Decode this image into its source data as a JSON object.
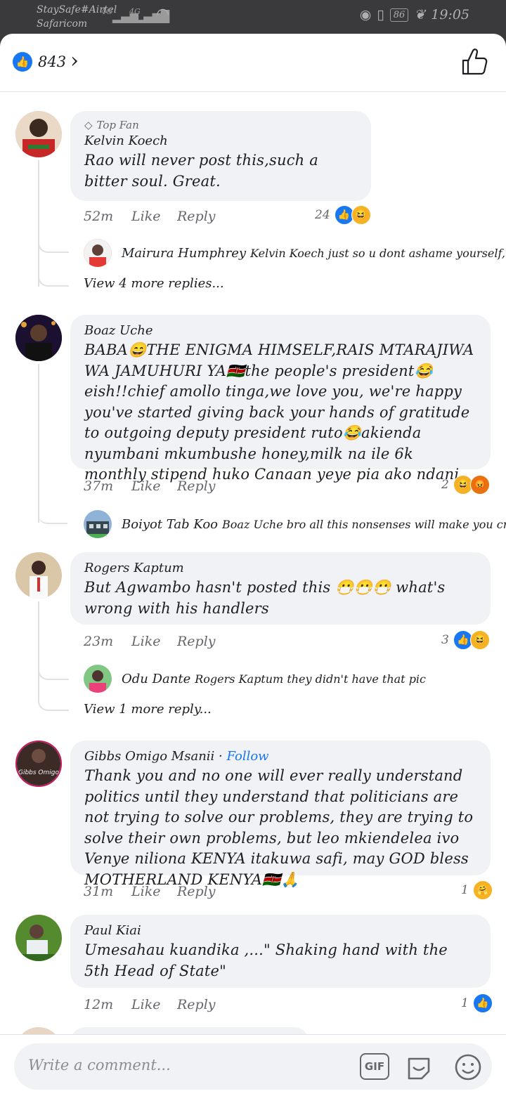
{
  "status": {
    "carrier1": "StaySafe#Airtel",
    "carrier2": "Safaricom",
    "net1": "4G",
    "net2": "4G",
    "battery": "86",
    "time": "19:05"
  },
  "header": {
    "like_count": "843"
  },
  "comments": [
    {
      "badge": "Top Fan",
      "author": "Kelvin Koech",
      "text": "Rao will never post this,such a bitter soul. Great.",
      "time": "52m",
      "like": "Like",
      "reply": "Reply",
      "reactions": "24",
      "reply_preview": {
        "name": "Mairura Humphrey",
        "text": "Kelvin Koech just so u dont ashame yourself, Ra..."
      },
      "more": "View 4 more replies..."
    },
    {
      "author": "Boaz Uche",
      "text": "BABA😄THE ENIGMA HIMSELF,RAIS MTARAJIWA WA JAMUHURI YA🇰🇪the people's president😂eish!!chief amollo tinga,we love you, we're happy you've started giving back your hands of gratitude to outgoing deputy president ruto😂akienda nyumbani mkumbushe honey,milk na ile 6k monthly stipend huko Canaan yeye pia ako ndani",
      "time": "37m",
      "like": "Like",
      "reply": "Reply",
      "reactions": "2",
      "reply_preview": {
        "name": "Boiyot Tab Koo",
        "text": "Boaz Uche bro all this nonsenses will make you cr..."
      }
    },
    {
      "author": "Rogers Kaptum",
      "text": "But Agwambo hasn't posted this 😷😷😷 what's wrong with his handlers",
      "time": "23m",
      "like": "Like",
      "reply": "Reply",
      "reactions": "3",
      "reply_preview": {
        "name": "Odu Dante",
        "text": "Rogers Kaptum they didn't have that pic"
      },
      "more": "View 1 more reply..."
    },
    {
      "author": "Gibbs Omigo  Msanii",
      "follow": "Follow",
      "text": "Thank you and no one will ever really understand politics until they understand that politicians are not trying to solve our problems, they are trying to solve their own problems, but leo mkiendelea ivo Venye niliona KENYA itakuwa safi, may GOD bless MOTHERLAND KENYA🇰🇪🙏",
      "time": "31m",
      "like": "Like",
      "reply": "Reply",
      "reactions": "1",
      "avatar_text": "Gibbs Omigo"
    },
    {
      "author": "Paul Kiai",
      "text": "Umesahau kuandika ,...\" Shaking hand with the 5th Head of State\"",
      "time": "12m",
      "like": "Like",
      "reply": "Reply",
      "reactions": "1"
    }
  ],
  "composer": {
    "placeholder": "Write a comment...",
    "gif": "GIF"
  },
  "colors": {
    "accent": "#1877f2",
    "bubble": "#f0f2f5",
    "muted": "#65676b"
  }
}
